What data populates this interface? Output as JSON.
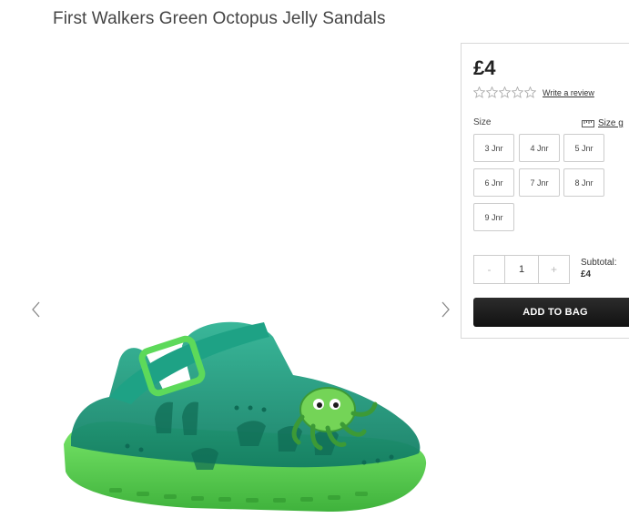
{
  "product": {
    "title": "First Walkers Green Octopus Jelly Sandals",
    "price": "£4",
    "rating_stars": 0,
    "review_link": "Write a review"
  },
  "size": {
    "label": "Size",
    "guide": "Size g",
    "options": [
      "3 Jnr",
      "4 Jnr",
      "5 Jnr",
      "6 Jnr",
      "7 Jnr",
      "8 Jnr",
      "9 Jnr"
    ]
  },
  "quantity": {
    "minus": "-",
    "value": "1",
    "plus": "+"
  },
  "subtotal": {
    "label": "Subtotal:",
    "amount": "£4"
  },
  "add_to_bag": "ADD TO BAG",
  "icons": {
    "prev": "chevron-left-icon",
    "next": "chevron-right-icon",
    "ruler": "ruler-icon",
    "star": "star-outline-icon"
  },
  "colors": {
    "sandal_body": "#1f9a7c",
    "sandal_sole": "#6ddf5a",
    "button": "#1a1a1a"
  }
}
